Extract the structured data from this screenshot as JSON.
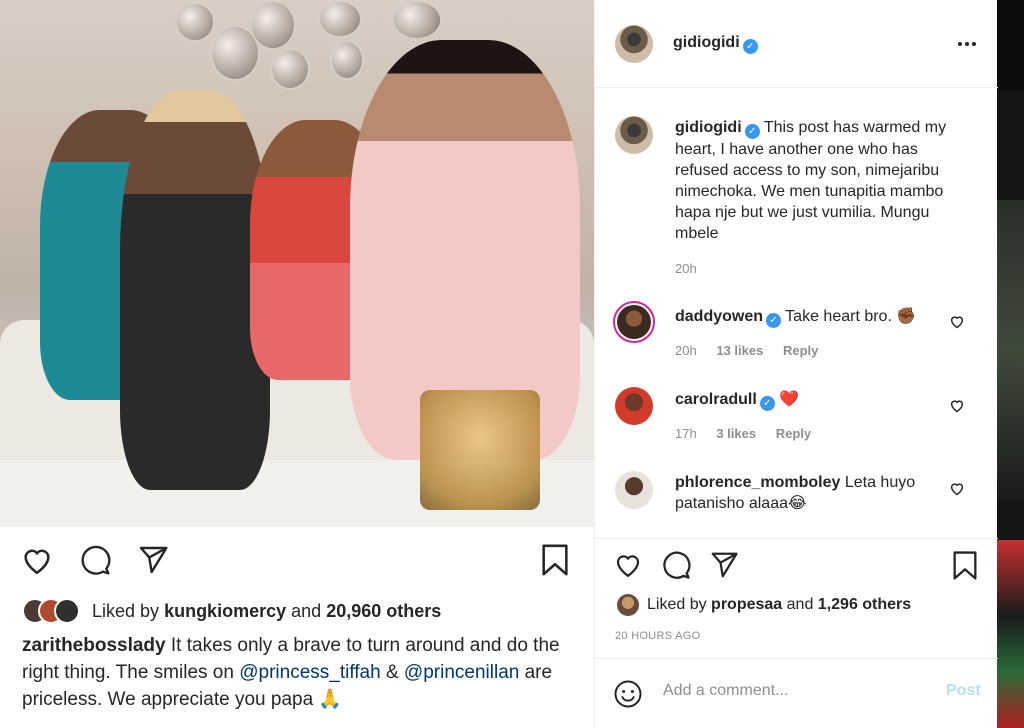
{
  "background_post": {
    "liked_by_prefix": "Liked by",
    "liked_by_user": "kungkiomercy",
    "liked_by_and": "and",
    "liked_by_others": "20,960 others",
    "caption": {
      "username": "zarithebosslady",
      "text_1": "It takes only a brave to turn around and do the right thing. The smiles on",
      "mention_1": "@princess_tiffah",
      "amp": "&",
      "mention_2": "@princenillan",
      "text_2": "are priceless. We appreciate you papa 🙏"
    }
  },
  "modal": {
    "header": {
      "username": "gidiogidi",
      "more_icon": "more-horizontal-icon"
    },
    "caption": {
      "username": "gidiogidi",
      "text": "This post has warmed my heart, I have another one who has refused access to my son, nimejaribu nimechoka. We men tunapitia mambo hapa nje but we just vumilia. Mungu mbele",
      "time": "20h"
    },
    "comments": [
      {
        "username": "daddyowen",
        "text": "Take heart bro. ✊🏾",
        "time": "20h",
        "likes": "13 likes",
        "reply": "Reply"
      },
      {
        "username": "carolradull",
        "text": "❤️",
        "time": "17h",
        "likes": "3 likes",
        "reply": "Reply"
      },
      {
        "username": "phlorence_momboley",
        "text": "Leta huyo patanisho alaaa😂"
      }
    ],
    "liked_by_prefix": "Liked by",
    "liked_by_user": "propesaa",
    "liked_by_and": "and",
    "liked_by_others": "1,296 others",
    "time_ago": "20 HOURS AGO",
    "add_comment_placeholder": "Add a comment...",
    "post_label": "Post"
  },
  "colors": {
    "verified": "#3897f0",
    "post_disabled": "#b2dffc",
    "mention": "#00376b"
  }
}
